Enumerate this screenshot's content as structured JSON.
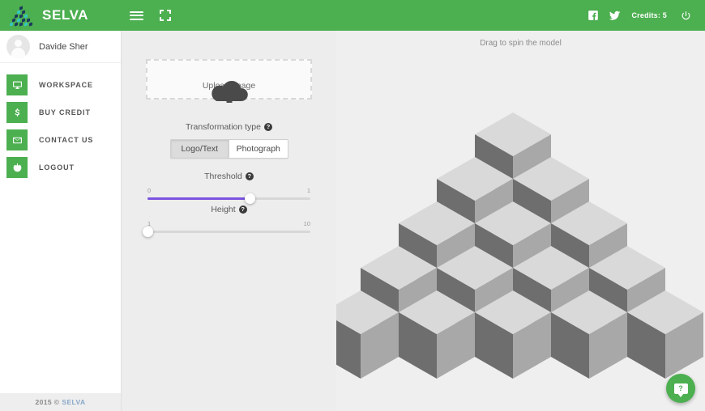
{
  "header": {
    "brand_name": "SELVA",
    "logo_icon": "selva-cube-triangle-logo",
    "menu_icon": "hamburger-menu-icon",
    "fullscreen_icon": "fullscreen-icon",
    "facebook_icon": "facebook-icon",
    "twitter_icon": "twitter-icon",
    "credits_label": "Credits: 5",
    "power_icon": "power-icon",
    "background_color": "#4caf50"
  },
  "sidebar": {
    "user_name": "Davide Sher",
    "avatar_icon": "user-avatar-icon",
    "items": [
      {
        "label": "WORKSPACE",
        "icon": "monitor-icon"
      },
      {
        "label": "BUY CREDIT",
        "icon": "dollar-icon"
      },
      {
        "label": "CONTACT US",
        "icon": "envelope-icon"
      },
      {
        "label": "LOGOUT",
        "icon": "power-icon"
      }
    ],
    "footer_year": "2015 ©",
    "footer_link": "SELVA"
  },
  "controls": {
    "upload": {
      "label": "Upload Image",
      "icon": "cloud-upload-icon"
    },
    "transformation": {
      "title": "Transformation type",
      "help_icon": "help-icon",
      "help_glyph": "?",
      "options": [
        {
          "label": "Logo/Text",
          "selected": true
        },
        {
          "label": "Photograph",
          "selected": false
        }
      ]
    },
    "threshold": {
      "title": "Threshold",
      "help_icon": "help-icon",
      "help_glyph": "?",
      "min_label": "0",
      "max_label": "1",
      "value_percent": 63,
      "fill_color": "#7a52e0"
    },
    "height": {
      "title": "Height",
      "help_icon": "help-icon",
      "help_glyph": "?",
      "min_label": "1",
      "max_label": "10",
      "value_percent": 0,
      "fill_color": "#7a52e0"
    }
  },
  "viewport": {
    "hint": "Drag to spin the model",
    "model": {
      "type": "isometric-cube-pyramid",
      "rows": 5,
      "cubes_per_row": [
        1,
        2,
        3,
        4,
        5
      ],
      "top_face_color": "#d9d9d9",
      "left_face_color": "#6e6e6e",
      "right_face_color": "#a8a8a8",
      "background_color": "#efefef"
    }
  },
  "chat": {
    "icon": "chat-help-icon",
    "glyph": "?",
    "color": "#4caf50"
  }
}
